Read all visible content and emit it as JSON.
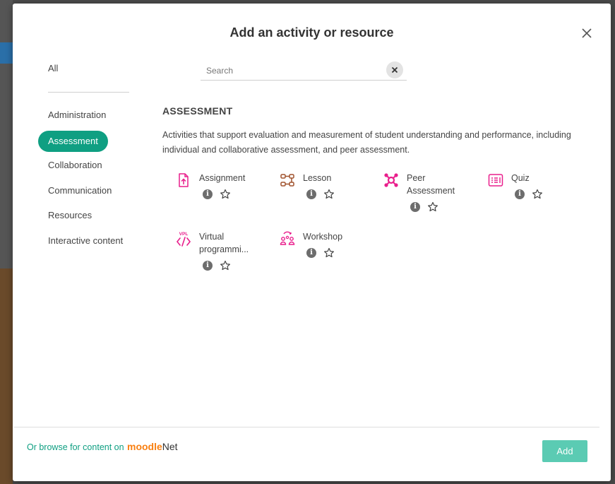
{
  "modal": {
    "title": "Add an activity or resource",
    "close_icon": "close-icon"
  },
  "search": {
    "placeholder": "Search",
    "value": "",
    "clear_icon": "clear-search-icon"
  },
  "sidebar": {
    "items": [
      {
        "label": "All",
        "active": false
      },
      {
        "label": "Administration",
        "active": false
      },
      {
        "label": "Assessment",
        "active": true
      },
      {
        "label": "Collaboration",
        "active": false
      },
      {
        "label": "Communication",
        "active": false
      },
      {
        "label": "Resources",
        "active": false
      },
      {
        "label": "Interactive content",
        "active": false
      }
    ]
  },
  "section": {
    "heading": "ASSESSMENT",
    "description": "Activities that support evaluation and measurement of student understanding and performance, including individual and collaborative assessment, and peer assessment."
  },
  "activities": [
    {
      "name": "Assignment",
      "icon": "assignment-icon"
    },
    {
      "name": "Lesson",
      "icon": "lesson-icon"
    },
    {
      "name": "Peer Assessment",
      "icon": "peer-assessment-icon"
    },
    {
      "name": "Quiz",
      "icon": "quiz-icon"
    },
    {
      "name": "Virtual programmi...",
      "icon": "vpl-icon"
    },
    {
      "name": "Workshop",
      "icon": "workshop-icon"
    }
  ],
  "footer": {
    "browse_text": "Or browse for content on",
    "logo_text": "moodleNet",
    "add_label": "Add"
  },
  "colors": {
    "accent": "#0f9f82",
    "add_button": "#5bcbb3",
    "activity_icon": "#e91e8c",
    "lesson_icon": "#a0522d",
    "moodle_orange": "#f98012"
  }
}
